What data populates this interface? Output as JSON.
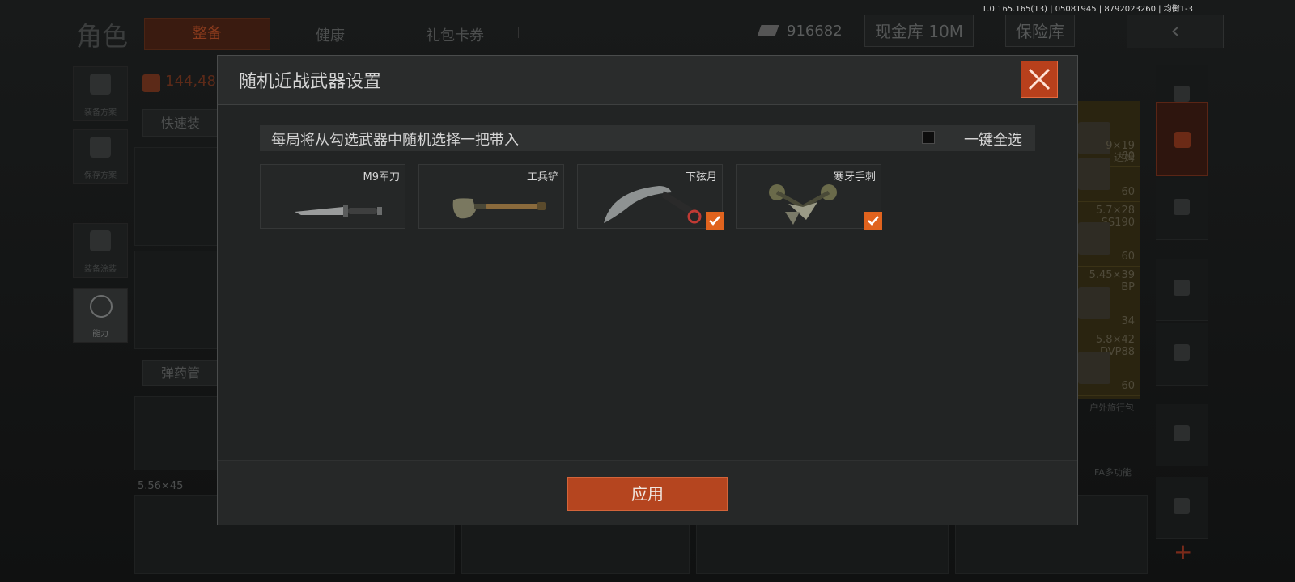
{
  "version": "1.0.165.165(13) | 05081945 | 8792023260 | 均衡1-3",
  "background": {
    "char_title": "角色",
    "tabs": [
      "整备",
      "健康",
      "礼包卡券"
    ],
    "money": "916682",
    "cash_vault": "现金库 10M",
    "safe_vault": "保险库",
    "back_icon": "chevron-left-icon",
    "left_menu": [
      "装备方案",
      "保存方案",
      "装备涂装",
      "能力"
    ],
    "weight": "144,48",
    "quick_equip": "快速装",
    "ammo_manager": "弹药管",
    "ammo_caliber": "5.56×45",
    "ammo_list": [
      {
        "name": "",
        "count": "60"
      },
      {
        "name": "9×19\n达姆",
        "count": "60"
      },
      {
        "name": "5.7×28\nSS190",
        "count": "60"
      },
      {
        "name": "5.45×39\nBP",
        "count": "34"
      },
      {
        "name": "5.8×42\nDVP88",
        "count": "60"
      }
    ],
    "bag_label": "户外旅行包",
    "fa_label": "FA多功能"
  },
  "dialog": {
    "title": "随机近战武器设置",
    "description": "每局将从勾选武器中随机选择一把带入",
    "select_all": "一键全选",
    "select_all_checked": false,
    "weapons": [
      {
        "name": "M9军刀",
        "checked": false
      },
      {
        "name": "工兵铲",
        "checked": false
      },
      {
        "name": "下弦月",
        "checked": true
      },
      {
        "name": "寒牙手刺",
        "checked": true
      }
    ],
    "apply": "应用"
  },
  "colors": {
    "accent": "#b8401c",
    "check": "#e0631e"
  }
}
